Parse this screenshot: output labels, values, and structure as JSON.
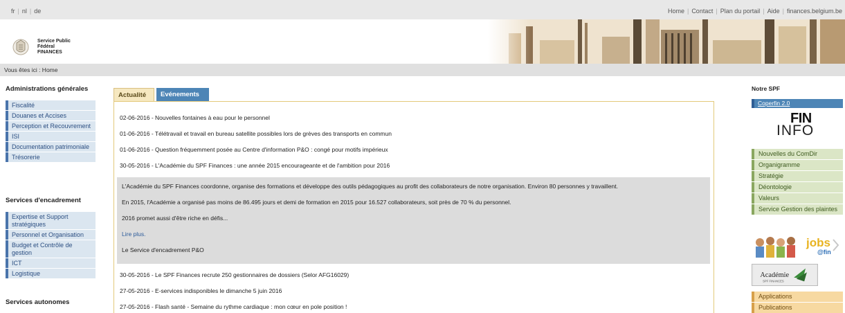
{
  "topbar": {
    "languages": [
      "fr",
      "nl",
      "de"
    ],
    "links": [
      "Home",
      "Contact",
      "Plan du portail",
      "Aide",
      "finances.belgium.be"
    ]
  },
  "logo": {
    "line1": "Service Public",
    "line2": "Fédéral",
    "line3": "FINANCES"
  },
  "breadcrumb": "Vous êtes ici : Home",
  "left_nav": {
    "heading1": "Administrations générales",
    "group1": [
      "Fiscalité",
      "Douanes et Accises",
      "Perception et Recouvrement",
      "ISI",
      "Documentation patrimoniale",
      "Trésorerie"
    ],
    "heading2": "Services d'encadrement",
    "group2": [
      "Expertise et Support stratégiques",
      "Personnel et Organisation",
      "Budget et Contrôle de gestion",
      "ICT",
      "Logistique"
    ],
    "heading3": "Services autonomes"
  },
  "tabs": {
    "actualite": "Actualité",
    "evenements": "Evénements"
  },
  "news": [
    "02-06-2016 - Nouvelles fontaines à eau pour le personnel",
    "01-06-2016 - Télétravail et travail en bureau satellite possibles lors de grèves des transports en commun",
    "01-06-2016 - Question fréquemment posée au Centre d'information P&O : congé pour motifs impérieux",
    "30-05-2016 - L'Académie du SPF Finances : une année 2015 encourageante et de l'ambition pour 2016"
  ],
  "detail": {
    "p1": "L'Académie du SPF Finances coordonne, organise des formations et développe des outils pédagogiques au profit des collaborateurs de notre organisation. Environ 80 personnes y travaillent.",
    "p2": "En 2015, l'Académie a organisé pas moins de 86.495 jours et demi de formation en 2015 pour 16.527 collaborateurs, soit près de 70 % du personnel.",
    "p3": "2016 promet aussi d'être riche en défis...",
    "more": "Lire plus.",
    "signature": "Le Service d'encadrement P&O"
  },
  "news2": [
    "30-05-2016 - Le SPF Finances recrute 250 gestionnaires de dossiers (Selor AFG16029)",
    "27-05-2016 - E-services indisponibles le dimanche 5 juin 2016",
    "27-05-2016 - Flash santé - Semaine du rythme cardiaque : mon cœur en pole position !"
  ],
  "right": {
    "heading": "Notre SPF",
    "coperfin": "Coperfin 2.0",
    "fin": "FIN",
    "info": "INFO",
    "green_links": [
      "Nouvelles du ComDir",
      "Organigramme",
      "Stratégie",
      "Déontologie",
      "Valeurs",
      "Service Gestion des plaintes"
    ],
    "jobs": "jobs",
    "jobs_sub": "@fin",
    "academie": "Académie",
    "academie_sub": "SPF FINANCES",
    "orange_links": [
      "Applications",
      "Publications"
    ]
  },
  "colors": {
    "nav_blue": "#4a74ab",
    "tab_active": "#f6e8c0",
    "tab_blue": "#4d85b6",
    "green": "#8aa760",
    "orange": "#d7a04a"
  }
}
